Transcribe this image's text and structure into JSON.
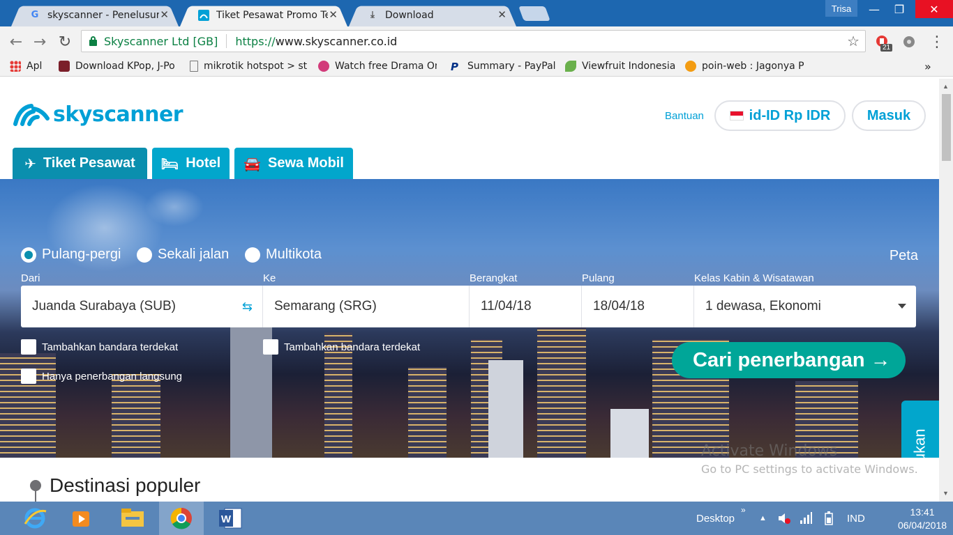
{
  "browser": {
    "tabs": [
      {
        "title": "skyscanner - Penelusuran",
        "active": false
      },
      {
        "title": "Tiket Pesawat Promo Ter",
        "active": true
      },
      {
        "title": "Download",
        "active": false
      }
    ],
    "profile_name": "Trisa",
    "omnibox": {
      "cert_name": "Skyscanner Ltd [GB]",
      "url_scheme": "https://",
      "url_host": "www.skyscanner.co.id"
    },
    "extension_badge": "21",
    "bookmarks": [
      {
        "label": "Apl",
        "icon": "apps-grid-icon"
      },
      {
        "label": "Download KPop, J-Po",
        "icon": "music-icon"
      },
      {
        "label": "mikrotik hotspot > st",
        "icon": "page-icon"
      },
      {
        "label": "Watch free Drama On",
        "icon": "drama-icon"
      },
      {
        "label": "Summary - PayPal",
        "icon": "paypal-icon"
      },
      {
        "label": "Viewfruit Indonesia",
        "icon": "leaf-icon"
      },
      {
        "label": "poin-web : Jagonya P",
        "icon": "coin-icon"
      }
    ]
  },
  "header": {
    "logo_text": "skyscanner",
    "help_label": "Bantuan",
    "locale_label": "id-ID Rp IDR",
    "login_label": "Masuk"
  },
  "verticals": [
    {
      "label": "Tiket Pesawat",
      "icon": "plane-icon",
      "active": true
    },
    {
      "label": "Hotel",
      "icon": "bed-icon",
      "active": false
    },
    {
      "label": "Sewa Mobil",
      "icon": "car-icon",
      "active": false
    }
  ],
  "search": {
    "trip_types": [
      {
        "label": "Pulang-pergi",
        "selected": true
      },
      {
        "label": "Sekali jalan",
        "selected": false
      },
      {
        "label": "Multikota",
        "selected": false
      }
    ],
    "map_label": "Peta",
    "labels": {
      "from": "Dari",
      "to": "Ke",
      "depart": "Berangkat",
      "return": "Pulang",
      "cabin": "Kelas Kabin & Wisatawan"
    },
    "values": {
      "from": "Juanda Surabaya (SUB)",
      "to": "Semarang (SRG)",
      "depart": "11/04/18",
      "return": "18/04/18",
      "cabin": "1 dewasa, Ekonomi"
    },
    "checkboxes": {
      "nearby_from": "Tambahkan bandara terdekat",
      "nearby_to": "Tambahkan bandara terdekat",
      "direct_only": "Hanya penerbangan langsung"
    },
    "submit_label": "Cari penerbangan →"
  },
  "feedback_label": "Masukan",
  "section_title": "Destinasi populer",
  "watermark": {
    "line1": "Activate Windows",
    "line2": "Go to PC settings to activate Windows."
  },
  "taskbar": {
    "desktop_label": "Desktop",
    "language": "IND",
    "time": "13:41",
    "date": "06/04/2018"
  },
  "colors": {
    "brand": "#00a0d6",
    "tab_active": "#0a8fae",
    "search_button": "#00a698"
  }
}
